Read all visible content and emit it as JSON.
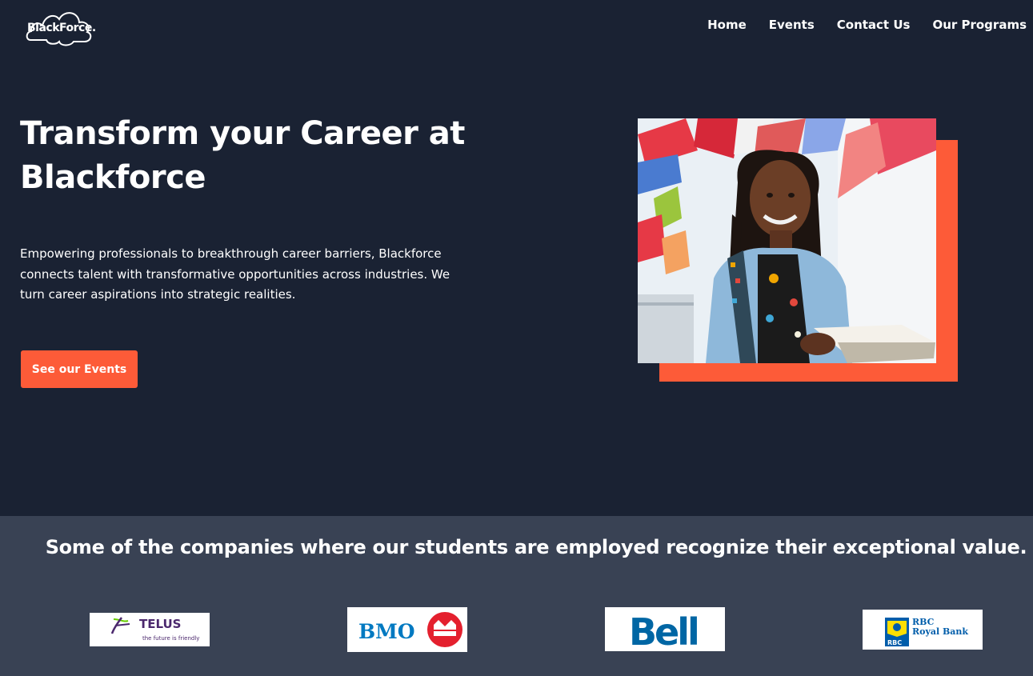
{
  "brand": {
    "logo_text": "BlackForce."
  },
  "nav": {
    "items": [
      "Home",
      "Events",
      "Contact Us",
      "Our Programs"
    ]
  },
  "hero": {
    "headline": "Transform your Career at Blackforce",
    "lead": "Empowering professionals to breakthrough career barriers, Blackforce connects talent with transformative opportunities across industries. We turn career aspirations into strategic realities.",
    "cta_label": "See our Events",
    "image_semantic": "student-holding-books-with-flags-photo"
  },
  "partners": {
    "heading": "Some of the companies where our students are employed recognize their exceptional value.",
    "logos": [
      {
        "name": "TELUS",
        "tagline": "the future is friendly"
      },
      {
        "name": "BMO"
      },
      {
        "name": "Bell"
      },
      {
        "name": "RBC Royal Bank",
        "line1": "RBC",
        "line2": "Royal Bank",
        "badge": "RBC"
      }
    ]
  },
  "colors": {
    "background": "#1a2233",
    "band": "#394254",
    "accent": "#fd5b38",
    "telus_purple": "#4b286d",
    "telus_green": "#66cc00",
    "bmo_blue": "#0079c1",
    "bmo_red": "#e4202e",
    "bell_blue": "#0066a4",
    "rbc_blue": "#005daa",
    "rbc_gold": "#fedf01"
  }
}
